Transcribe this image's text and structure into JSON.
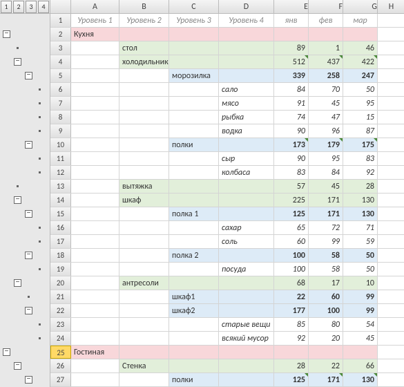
{
  "outline_levels": [
    "1",
    "2",
    "3",
    "4"
  ],
  "columns": {
    "A": "A",
    "B": "B",
    "C": "C",
    "D": "D",
    "E": "E",
    "F": "F",
    "G": "G",
    "H": "H"
  },
  "headers": {
    "l1": "Уровень 1",
    "l2": "Уровень 2",
    "l3": "Уровень 3",
    "l4": "Уровень 4",
    "m1": "янв",
    "m2": "фев",
    "m3": "мар"
  },
  "rows": {
    "r2": {
      "a": "Кухня"
    },
    "r3": {
      "b": "стол",
      "e": "89",
      "f": "1",
      "g": "46"
    },
    "r4": {
      "b": "холодильник",
      "e": "512",
      "f": "437",
      "g": "422"
    },
    "r5": {
      "c": "морозилка",
      "e": "339",
      "f": "258",
      "g": "247"
    },
    "r6": {
      "d": "сало",
      "e": "84",
      "f": "70",
      "g": "50"
    },
    "r7": {
      "d": "мясо",
      "e": "91",
      "f": "45",
      "g": "95"
    },
    "r8": {
      "d": "рыбка",
      "e": "74",
      "f": "47",
      "g": "15"
    },
    "r9": {
      "d": "водка",
      "e": "90",
      "f": "96",
      "g": "87"
    },
    "r10": {
      "c": "полки",
      "e": "173",
      "f": "179",
      "g": "175"
    },
    "r11": {
      "d": "сыр",
      "e": "90",
      "f": "95",
      "g": "83"
    },
    "r12": {
      "d": "колбаса",
      "e": "83",
      "f": "84",
      "g": "92"
    },
    "r13": {
      "b": "вытяжка",
      "e": "57",
      "f": "45",
      "g": "28"
    },
    "r14": {
      "b": "шкаф",
      "e": "225",
      "f": "171",
      "g": "130"
    },
    "r15": {
      "c": "полка 1",
      "e": "125",
      "f": "171",
      "g": "130"
    },
    "r16": {
      "d": "сахар",
      "e": "65",
      "f": "72",
      "g": "71"
    },
    "r17": {
      "d": "соль",
      "e": "60",
      "f": "99",
      "g": "59"
    },
    "r18": {
      "c": "полка 2",
      "e": "100",
      "f": "58",
      "g": "50"
    },
    "r19": {
      "d": "посуда",
      "e": "100",
      "f": "58",
      "g": "50"
    },
    "r20": {
      "b": "антресоли",
      "e": "68",
      "f": "17",
      "g": "10"
    },
    "r21": {
      "c": "шкаф1",
      "e": "22",
      "f": "60",
      "g": "99"
    },
    "r22": {
      "c": "шкаф2",
      "e": "177",
      "f": "100",
      "g": "99"
    },
    "r23": {
      "d": "старые вещи",
      "e": "85",
      "f": "80",
      "g": "54"
    },
    "r24": {
      "d": "всякий мусор",
      "e": "92",
      "f": "20",
      "g": "45"
    },
    "r25": {
      "a": "Гостиная"
    },
    "r26": {
      "b": "Стенка",
      "e": "28",
      "f": "22",
      "g": "66"
    },
    "r27": {
      "c": "полки",
      "e": "125",
      "f": "171",
      "g": "130"
    }
  }
}
